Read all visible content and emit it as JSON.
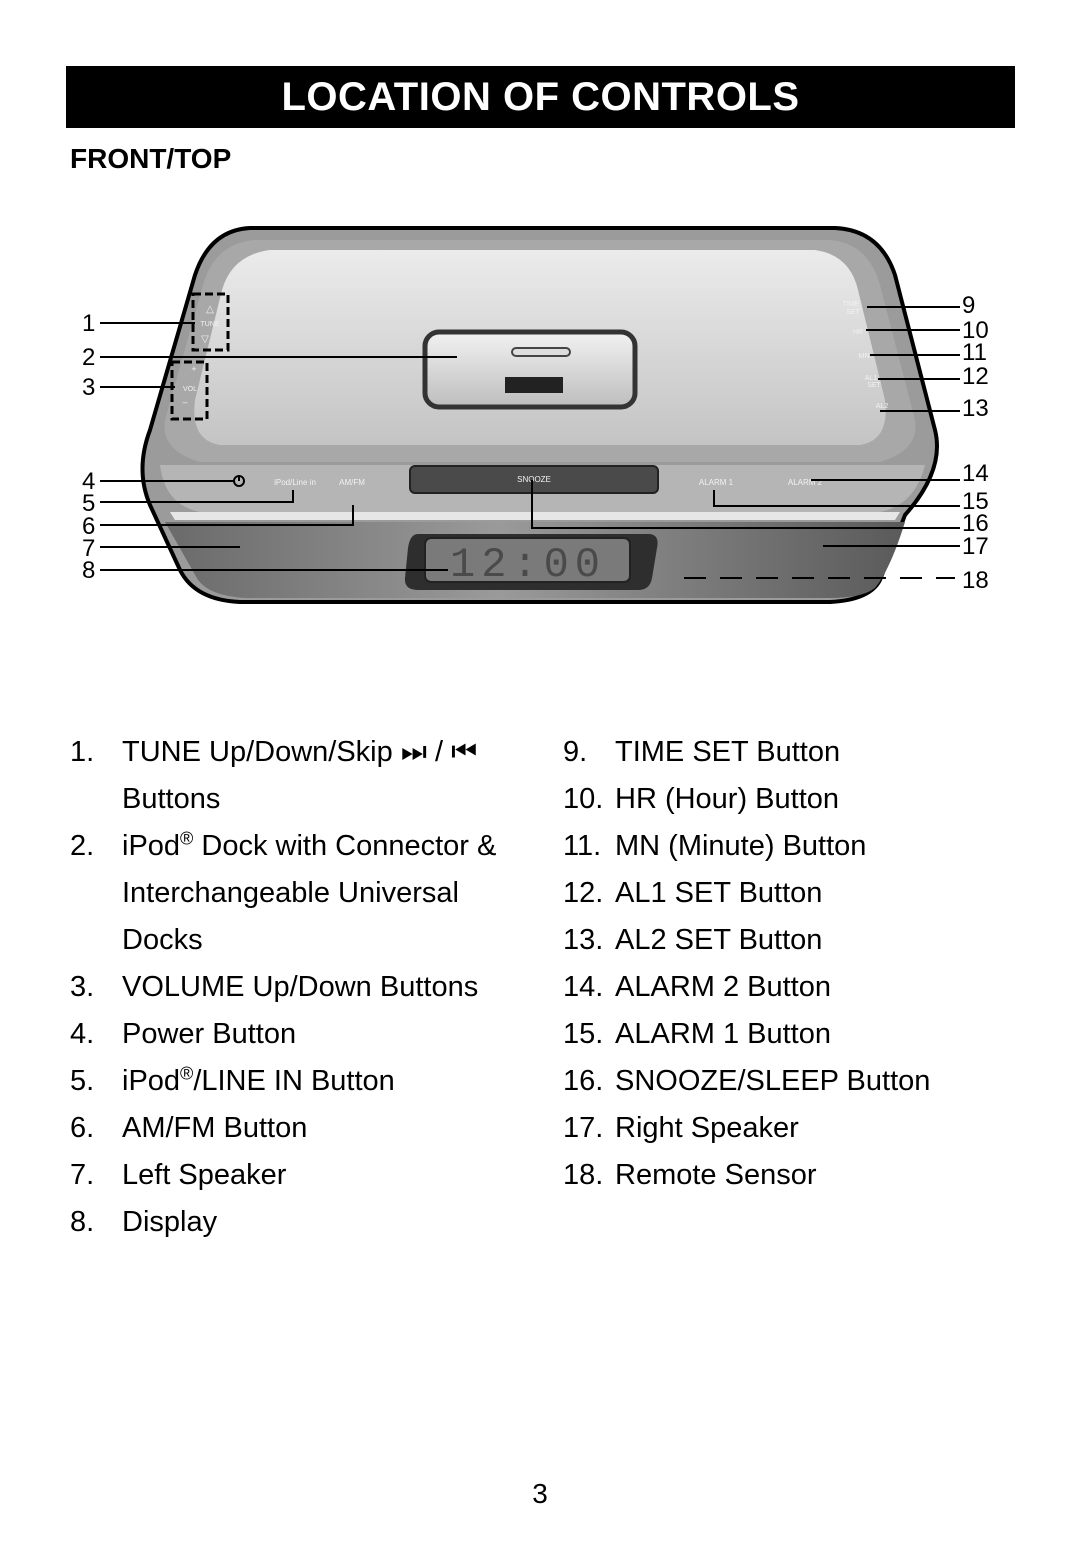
{
  "header": {
    "title": "LOCATION OF CONTROLS"
  },
  "section": {
    "title": "FRONT/TOP"
  },
  "diagram": {
    "device_labels": {
      "tune": "TUNE",
      "vol": "VOL",
      "vol_plus": "+",
      "vol_minus": "–",
      "time_set_line1": "TIME",
      "time_set_line2": "SET",
      "hr": "HR",
      "mn": "MN",
      "al1_set_line1": "AL1",
      "al1_set_line2": "SET",
      "al2_set": "AL2",
      "ipod_line_in": "iPod/Line in",
      "am_fm": "AM/FM",
      "snooze": "SNOOZE",
      "alarm1": "ALARM 1",
      "alarm2": "ALARM 2",
      "display_time": "12:00"
    },
    "callouts": [
      "1",
      "2",
      "3",
      "4",
      "5",
      "6",
      "7",
      "8",
      "9",
      "10",
      "11",
      "12",
      "13",
      "14",
      "15",
      "16",
      "17",
      "18"
    ]
  },
  "controls_left": [
    {
      "num": "1.",
      "text_a": "TUNE Up/Down/Skip ",
      "icons": "⏭ / ⏮",
      "text_b": "Buttons"
    },
    {
      "num": "2.",
      "text_a": "iPod",
      "sup": "®",
      "text_b": " Dock with Connector & Interchangeable Universal Docks"
    },
    {
      "num": "3.",
      "text": "VOLUME Up/Down Buttons"
    },
    {
      "num": "4.",
      "text": "Power Button"
    },
    {
      "num": "5.",
      "text_a": "iPod",
      "sup": "®",
      "text_b": "/LINE IN Button"
    },
    {
      "num": "6.",
      "text": "AM/FM Button"
    },
    {
      "num": "7.",
      "text": "Left Speaker"
    },
    {
      "num": "8.",
      "text": "Display"
    }
  ],
  "controls_right": [
    {
      "num": "9.",
      "text": "TIME SET Button"
    },
    {
      "num": "10.",
      "text": "HR (Hour) Button"
    },
    {
      "num": "11.",
      "text": "MN (Minute) Button"
    },
    {
      "num": "12.",
      "text": "AL1 SET Button"
    },
    {
      "num": "13.",
      "text": "AL2 SET Button"
    },
    {
      "num": "14.",
      "text": "ALARM 2 Button"
    },
    {
      "num": "15.",
      "text": "ALARM 1 Button"
    },
    {
      "num": "16.",
      "text": "SNOOZE/SLEEP Button"
    },
    {
      "num": "17.",
      "text": "Right Speaker"
    },
    {
      "num": "18.",
      "text": "Remote Sensor"
    }
  ],
  "footer": {
    "page_number": "3"
  }
}
